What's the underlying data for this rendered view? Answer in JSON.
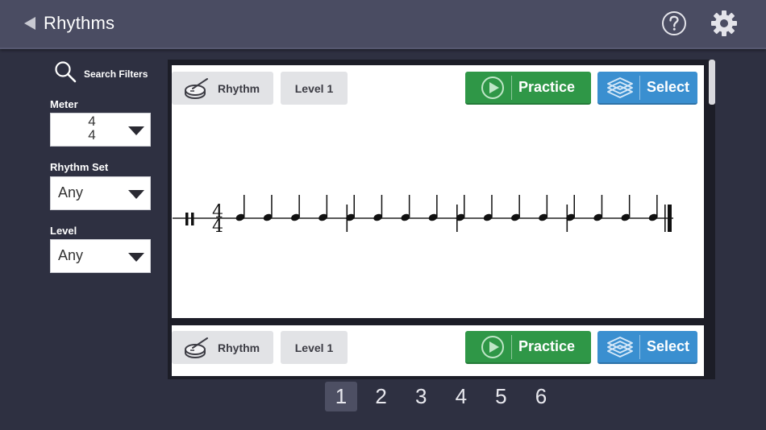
{
  "header": {
    "title": "Rhythms"
  },
  "sidebar": {
    "search_label": "Search Filters",
    "meter": {
      "label": "Meter",
      "numerator": "4",
      "denominator": "4"
    },
    "rhythm_set": {
      "label": "Rhythm Set",
      "value": "Any"
    },
    "level": {
      "label": "Level",
      "value": "Any"
    }
  },
  "cards": [
    {
      "type_label": "Rhythm",
      "level_label": "Level 1",
      "practice_label": "Practice",
      "select_label": "Select",
      "notation": {
        "time_signature": {
          "numerator": "4",
          "denominator": "4"
        },
        "measures": 4,
        "notes_per_measure": 4,
        "note_value": "quarter"
      }
    },
    {
      "type_label": "Rhythm",
      "level_label": "Level 1",
      "practice_label": "Practice",
      "select_label": "Select"
    }
  ],
  "pagination": {
    "pages": [
      "1",
      "2",
      "3",
      "4",
      "5",
      "6"
    ],
    "current": "1"
  },
  "colors": {
    "background": "#2e3041",
    "header": "#4a4c62",
    "practice": "#2f9747",
    "select": "#3a8fd0"
  },
  "icons": {
    "back": "back-arrow-icon",
    "help": "help-icon",
    "settings": "gear-icon",
    "search": "search-icon",
    "rhythm": "drum-icon",
    "practice": "play-icon",
    "select": "stack-icon"
  }
}
